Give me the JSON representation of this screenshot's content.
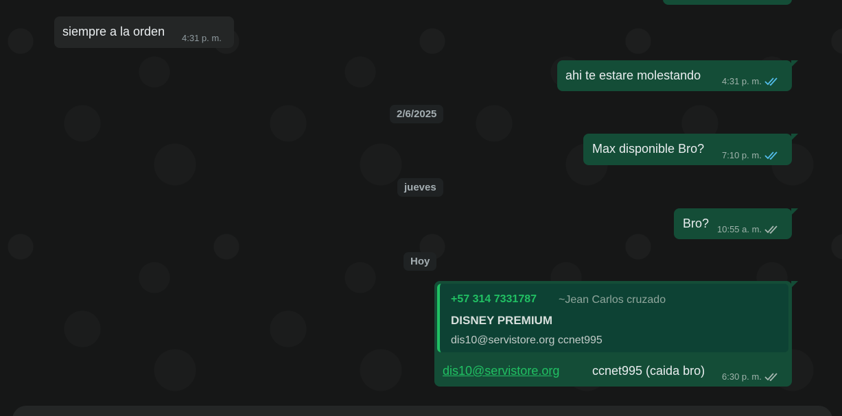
{
  "messages": {
    "top_partial": {
      "direction": "outgoing"
    },
    "m1": {
      "direction": "incoming",
      "text": "siempre a la orden",
      "time": "4:31 p. m."
    },
    "m2": {
      "direction": "outgoing",
      "text": "ahi te estare molestando",
      "time": "4:31 p. m.",
      "status": "read"
    },
    "m3": {
      "direction": "outgoing",
      "text": "Max disponible Bro?",
      "time": "7:10 p. m.",
      "status": "read"
    },
    "m4": {
      "direction": "outgoing",
      "text": "Bro?",
      "time": "10:55 a. m.",
      "status": "delivered"
    },
    "m5": {
      "direction": "outgoing",
      "quoted": {
        "sender_phone": "+57 314 7331787",
        "sender_name": "~Jean Carlos cruzado",
        "title": "DISNEY PREMIUM",
        "body": "dis10@servistore.org ccnet995"
      },
      "link_text": "dis10@servistore.org",
      "text": "ccnet995 (caida bro)",
      "time": "6:30 p. m.",
      "status": "delivered"
    }
  },
  "date_separators": {
    "d1": "2/6/2025",
    "d2": "jueves",
    "d3": "Hoy"
  },
  "colors": {
    "background": "#161717",
    "incoming_bubble": "#242626",
    "outgoing_bubble": "#144d37",
    "accent_green": "#21c063",
    "read_tick_blue": "#53bdeb",
    "delivered_tick_gray": "#a9b8b2"
  },
  "icons": {
    "read_status": "double-check-blue-icon",
    "delivered_status": "double-check-gray-icon"
  }
}
